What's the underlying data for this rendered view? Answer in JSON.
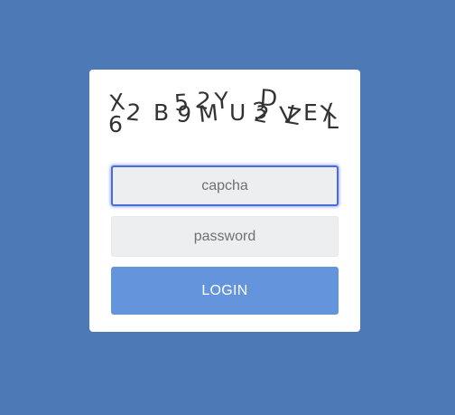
{
  "captcha": {
    "chars": [
      "X",
      "6",
      "2",
      "B",
      "5",
      "9",
      "M",
      "2",
      "Y",
      "U",
      "D",
      "3",
      "2",
      "V",
      "Z",
      "E",
      "X",
      "L"
    ]
  },
  "form": {
    "captcha_placeholder": "capcha",
    "password_placeholder": "password",
    "login_label": "LOGIN"
  }
}
